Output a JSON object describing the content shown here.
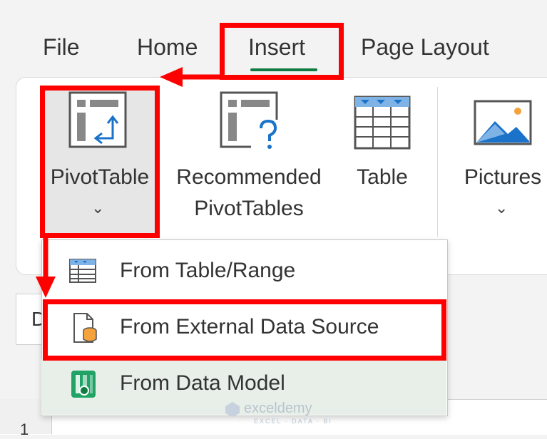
{
  "tabs": {
    "file": "File",
    "home": "Home",
    "insert": "Insert",
    "page_layout": "Page Layout"
  },
  "ribbon": {
    "pivottable": "PivotTable",
    "recommended_line1": "Recommended",
    "recommended_line2": "PivotTables",
    "table": "Table",
    "pictures": "Pictures"
  },
  "namebox": {
    "partial_text": "D"
  },
  "row_header": {
    "first": "1"
  },
  "menu": {
    "items": [
      {
        "label": "From Table/Range",
        "icon": "table-range-icon"
      },
      {
        "label": "From External Data Source",
        "icon": "external-data-source-icon"
      },
      {
        "label": "From Data Model",
        "icon": "data-model-icon"
      }
    ]
  },
  "watermark": {
    "name": "exceldemy",
    "tagline": "EXCEL · DATA · BI"
  },
  "colors": {
    "highlight_red": "#ff0000",
    "accent_green": "#107c41",
    "icon_blue": "#1a73c9",
    "icon_orange": "#f4a23a"
  }
}
